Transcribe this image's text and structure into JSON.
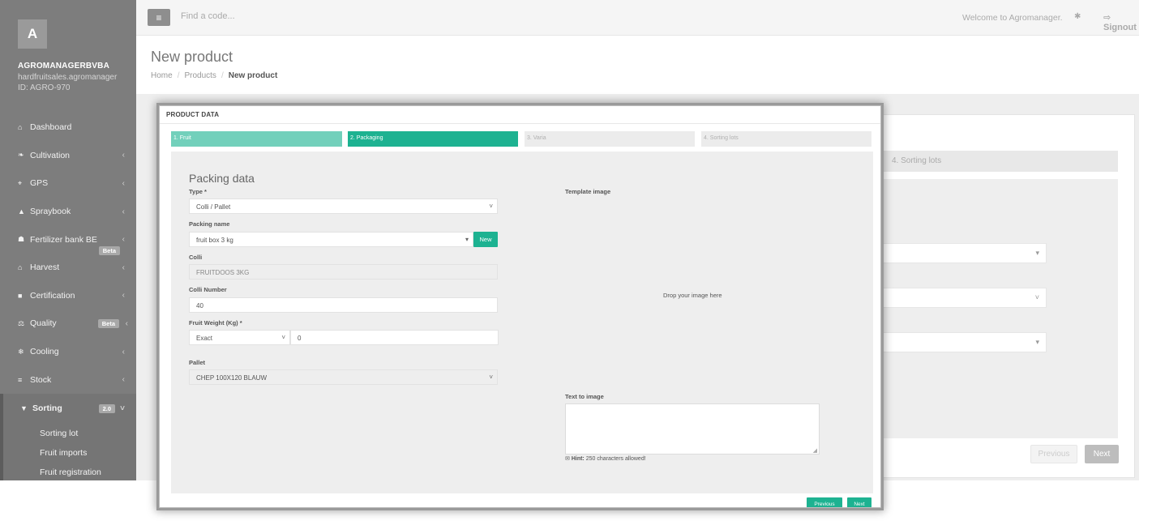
{
  "sidebar": {
    "avatar_letter": "A",
    "company": "AGROMANAGERBVBA",
    "domain": "hardfruitsales.agromanager",
    "id": "ID: AGRO-970",
    "items": [
      {
        "icon": "⌂",
        "label": "Dashboard",
        "chevron": ""
      },
      {
        "icon": "❧",
        "label": "Cultivation",
        "chevron": "‹"
      },
      {
        "icon": "⌖",
        "label": "GPS",
        "chevron": "‹"
      },
      {
        "icon": "▲",
        "label": "Spraybook",
        "chevron": "‹"
      },
      {
        "icon": "☗",
        "label": "Fertilizer bank BE",
        "chevron": "‹",
        "badge": "Beta"
      },
      {
        "icon": "⌂",
        "label": "Harvest",
        "chevron": "‹"
      },
      {
        "icon": "■",
        "label": "Certification",
        "chevron": "‹"
      },
      {
        "icon": "⚖",
        "label": "Quality",
        "chevron": "‹",
        "badge": "Beta"
      },
      {
        "icon": "❄",
        "label": "Cooling",
        "chevron": "‹"
      },
      {
        "icon": "≡",
        "label": "Stock",
        "chevron": "‹"
      }
    ],
    "active_item": {
      "icon": "▼",
      "label": "Sorting",
      "badge": "2.0",
      "chevron": "˅"
    },
    "sub_items": [
      "Sorting lot",
      "Fruit imports",
      "Fruit registration"
    ]
  },
  "topbar": {
    "menu_icon": "≡",
    "search_placeholder": "Find a code...",
    "welcome": "Welcome to Agromanager.",
    "bug_icon": "✱",
    "signout": "⇨ Signout"
  },
  "page": {
    "title": "New product",
    "breadcrumb": {
      "home": "Home",
      "sep": "/",
      "products": "Products",
      "current": "New product"
    }
  },
  "background": {
    "step4": "4. Sorting lots",
    "previous": "Previous",
    "next": "Next",
    "caret_a": "▾",
    "caret_b": "˅"
  },
  "modal": {
    "header": "PRODUCT DATA",
    "steps": [
      "1. Fruit",
      "2. Packaging",
      "3. Varia",
      "4. Sorting lots"
    ],
    "section_title": "Packing data",
    "type_label": "Type *",
    "type_value": "Colli / Pallet",
    "packing_name_label": "Packing name",
    "packing_name_value": "fruit box 3 kg",
    "new_button": "New",
    "colli_label": "Colli",
    "colli_value": "FRUITDOOS 3KG",
    "colli_number_label": "Colli Number",
    "colli_number_value": "40",
    "fruit_weight_label": "Fruit Weight (Kg) *",
    "fruit_weight_mode": "Exact",
    "fruit_weight_value": "0",
    "pallet_label": "Pallet",
    "pallet_value": "CHEP 100X120 BLAUW",
    "template_image_label": "Template image",
    "drop_text": "Drop your image here",
    "text_to_image_label": "Text to image",
    "hint_icon": "✉",
    "hint_bold": "Hint:",
    "hint_text": " 250 characters allowed!",
    "previous": "Previous",
    "next": "Next",
    "caret": "˅",
    "caret_small": "▾",
    "grip": "◢"
  }
}
